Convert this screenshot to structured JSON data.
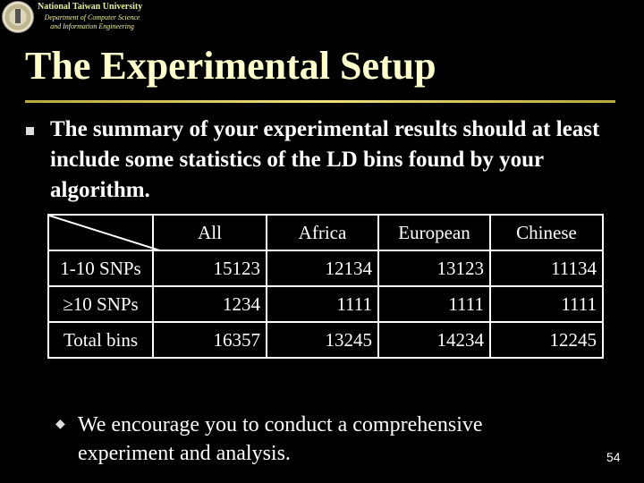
{
  "header": {
    "university": "National Taiwan University",
    "department_line1": "Department of Computer Science",
    "department_line2": "and Information Engineering"
  },
  "title": "The Experimental Setup",
  "bullet1": "The summary of your experimental results should at least include some statistics of the LD bins found by your algorithm.",
  "table": {
    "columns": [
      "All",
      "Africa",
      "European",
      "Chinese"
    ],
    "rows": [
      {
        "label": "1-10 SNPs",
        "values": [
          "15123",
          "12134",
          "13123",
          "11134"
        ]
      },
      {
        "label": "≥10 SNPs",
        "values": [
          "1234",
          "1111",
          "1111",
          "1111"
        ]
      },
      {
        "label": "Total bins",
        "values": [
          "16357",
          "13245",
          "14234",
          "12245"
        ]
      }
    ]
  },
  "sub_bullet": "We encourage you to conduct a comprehensive experiment and analysis.",
  "page_number": "54",
  "colors": {
    "title": "#ffffcc",
    "rule": "#d8c860",
    "background": "#000000"
  }
}
